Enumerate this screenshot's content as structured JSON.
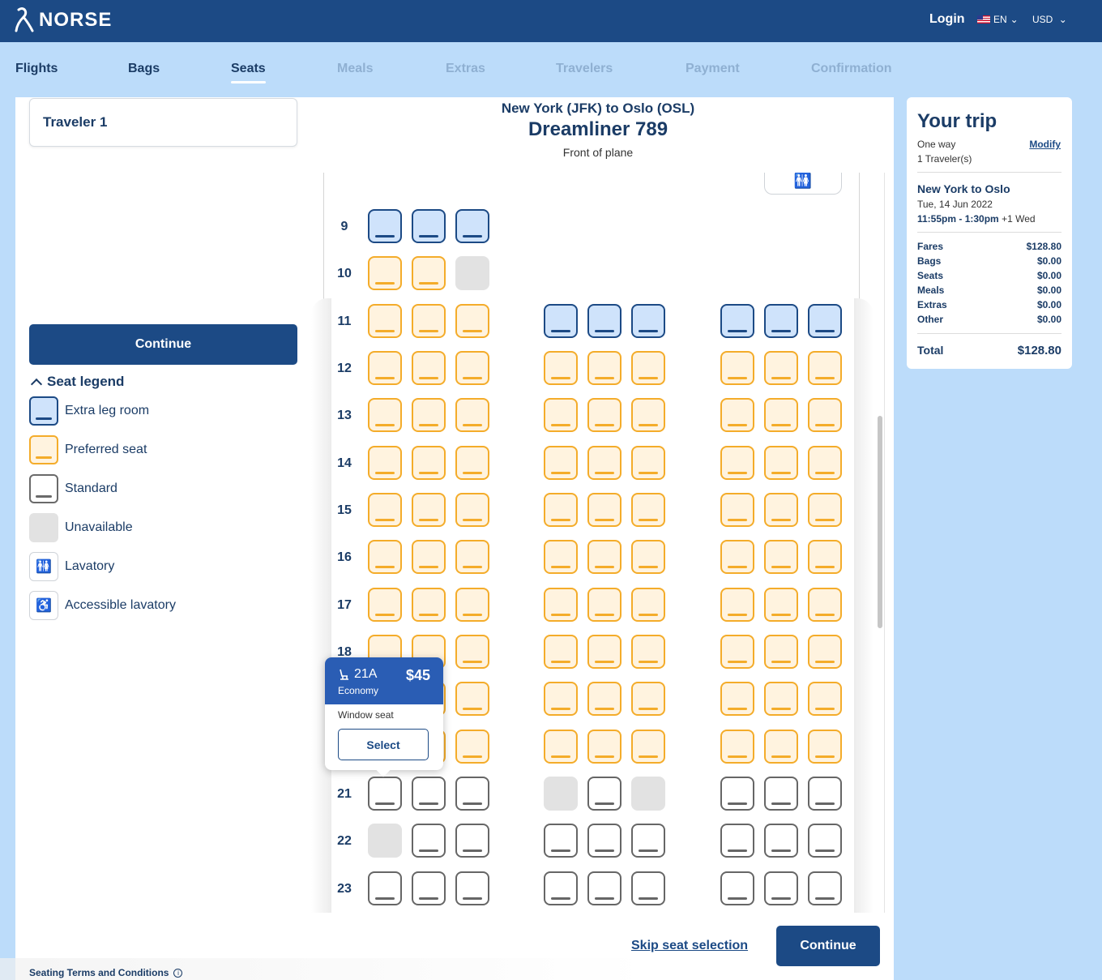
{
  "brand": {
    "name": "NORSE"
  },
  "header": {
    "login": "Login",
    "language": "EN",
    "currency": "USD"
  },
  "nav": {
    "tabs": [
      {
        "label": "Flights",
        "state": "done"
      },
      {
        "label": "Bags",
        "state": "done"
      },
      {
        "label": "Seats",
        "state": "active"
      },
      {
        "label": "Meals",
        "state": "disabled"
      },
      {
        "label": "Extras",
        "state": "disabled"
      },
      {
        "label": "Travelers",
        "state": "disabled"
      },
      {
        "label": "Payment",
        "state": "disabled"
      },
      {
        "label": "Confirmation",
        "state": "disabled"
      }
    ]
  },
  "sidebar": {
    "traveler": "Traveler 1",
    "continue_label": "Continue",
    "legend_title": "Seat legend",
    "legend": [
      {
        "type": "extra",
        "label": "Extra leg room"
      },
      {
        "type": "pref",
        "label": "Preferred seat"
      },
      {
        "type": "std",
        "label": "Standard"
      },
      {
        "type": "unav",
        "label": "Unavailable"
      },
      {
        "type": "lav",
        "label": "Lavatory",
        "icon": "lavatory-icon"
      },
      {
        "type": "acc",
        "label": "Accessible lavatory",
        "icon": "accessible-icon"
      }
    ],
    "terms": "Seating Terms and Conditions"
  },
  "flight": {
    "route": "New York (JFK) to Oslo (OSL)",
    "aircraft": "Dreamliner 789",
    "orientation": "Front of plane"
  },
  "seatmap": {
    "rows": [
      {
        "number": "9",
        "seats": [
          "extra",
          "extra",
          "extra",
          null,
          null,
          null,
          null,
          null,
          null
        ]
      },
      {
        "number": "10",
        "seats": [
          "pref",
          "pref",
          "unav",
          null,
          null,
          null,
          null,
          null,
          null
        ]
      },
      {
        "number": "11",
        "seats": [
          "pref",
          "pref",
          "pref",
          "extra",
          "extra",
          "extra",
          "extra",
          "extra",
          "extra"
        ]
      },
      {
        "number": "12",
        "seats": [
          "pref",
          "pref",
          "pref",
          "pref",
          "pref",
          "pref",
          "pref",
          "pref",
          "pref"
        ]
      },
      {
        "number": "13",
        "seats": [
          "pref",
          "pref",
          "pref",
          "pref",
          "pref",
          "pref",
          "pref",
          "pref",
          "pref"
        ]
      },
      {
        "number": "14",
        "seats": [
          "pref",
          "pref",
          "pref",
          "pref",
          "pref",
          "pref",
          "pref",
          "pref",
          "pref"
        ]
      },
      {
        "number": "15",
        "seats": [
          "pref",
          "pref",
          "pref",
          "pref",
          "pref",
          "pref",
          "pref",
          "pref",
          "pref"
        ]
      },
      {
        "number": "16",
        "seats": [
          "pref",
          "pref",
          "pref",
          "pref",
          "pref",
          "pref",
          "pref",
          "pref",
          "pref"
        ]
      },
      {
        "number": "17",
        "seats": [
          "pref",
          "pref",
          "pref",
          "pref",
          "pref",
          "pref",
          "pref",
          "pref",
          "pref"
        ]
      },
      {
        "number": "18",
        "seats": [
          "pref",
          "pref",
          "pref",
          "pref",
          "pref",
          "pref",
          "pref",
          "pref",
          "pref"
        ]
      },
      {
        "number": "",
        "seats": [
          "pref",
          "pref",
          "pref",
          "pref",
          "pref",
          "pref",
          "pref",
          "pref",
          "pref"
        ]
      },
      {
        "number": "",
        "seats": [
          "pref",
          "pref",
          "pref",
          "pref",
          "pref",
          "pref",
          "pref",
          "pref",
          "pref"
        ]
      },
      {
        "number": "21",
        "seats": [
          "std",
          "std",
          "std",
          "unav",
          "std",
          "unav",
          "std",
          "std",
          "std"
        ]
      },
      {
        "number": "22",
        "seats": [
          "unav",
          "std",
          "std",
          "std",
          "std",
          "std",
          "std",
          "std",
          "std"
        ]
      },
      {
        "number": "23",
        "seats": [
          "std",
          "std",
          "std",
          "std",
          "std",
          "std",
          "std",
          "std",
          "std"
        ]
      }
    ]
  },
  "popover": {
    "seat": "21A",
    "price": "$45",
    "cabin": "Economy",
    "description": "Window seat",
    "select_label": "Select"
  },
  "footer": {
    "skip": "Skip seat selection",
    "continue_label": "Continue"
  },
  "trip": {
    "title": "Your trip",
    "type": "One way",
    "modify": "Modify",
    "travelers": "1 Traveler(s)",
    "route": "New York to Oslo",
    "date": "Tue, 14 Jun 2022",
    "time": "11:55pm - 1:30pm",
    "day_offset": "+1 Wed",
    "prices": [
      {
        "label": "Fares",
        "value": "$128.80"
      },
      {
        "label": "Bags",
        "value": "$0.00"
      },
      {
        "label": "Seats",
        "value": "$0.00"
      },
      {
        "label": "Meals",
        "value": "$0.00"
      },
      {
        "label": "Extras",
        "value": "$0.00"
      },
      {
        "label": "Other",
        "value": "$0.00"
      }
    ],
    "total_label": "Total",
    "total_value": "$128.80"
  }
}
